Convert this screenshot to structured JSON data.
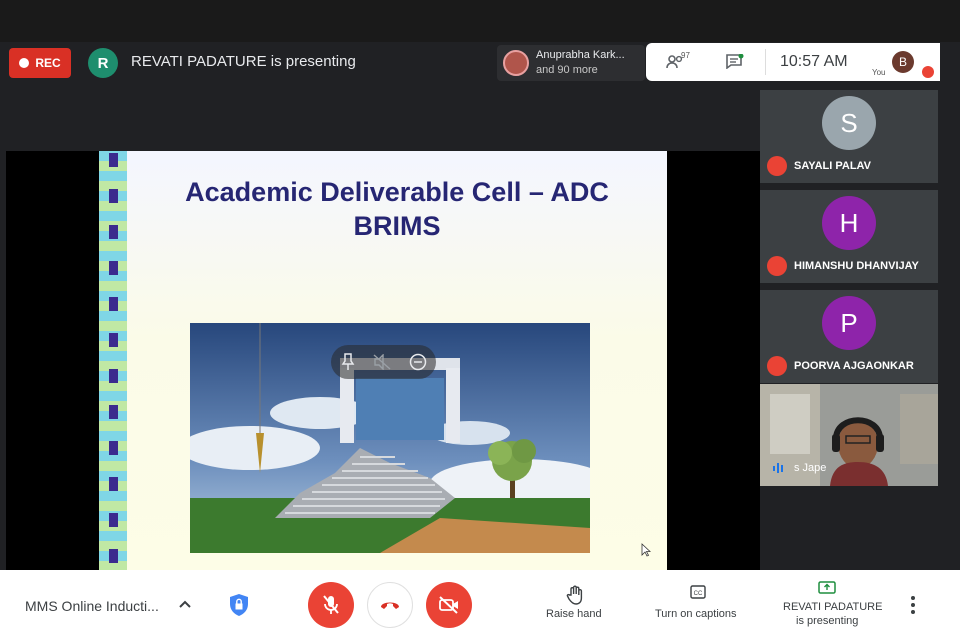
{
  "top": {
    "rec_label": "REC",
    "presenter_initial": "R",
    "presenting_text": "REVATI PADATURE is presenting",
    "people_chip_line1": "Anuprabha Kark...",
    "people_chip_line2": "and 90 more",
    "participant_count": "97",
    "time": "10:57 AM",
    "you_label": "You",
    "self_initial": "B"
  },
  "slide": {
    "title_line1": "Academic Deliverable Cell – ADC",
    "title_line2": "BRIMS"
  },
  "sidebar": {
    "participants": [
      {
        "initial": "S",
        "name": "SAYALI PALAV",
        "color": "#9aa6ad"
      },
      {
        "initial": "H",
        "name": "HIMANSHU DHANVIJAY",
        "color": "#8e24aa"
      },
      {
        "initial": "P",
        "name": "POORVA AJGAONKAR",
        "color": "#8e24aa"
      }
    ],
    "video_name": "s Jape"
  },
  "bottom": {
    "meeting_name": "MMS Online Inducti...",
    "raise_hand": "Raise hand",
    "captions": "Turn on captions",
    "presenting_line1": "REVATI PADATURE",
    "presenting_line2": "is presenting"
  },
  "colors": {
    "danger": "#ea4335",
    "presenter_avatar": "#1e8e6e",
    "slide_title": "#262673"
  }
}
